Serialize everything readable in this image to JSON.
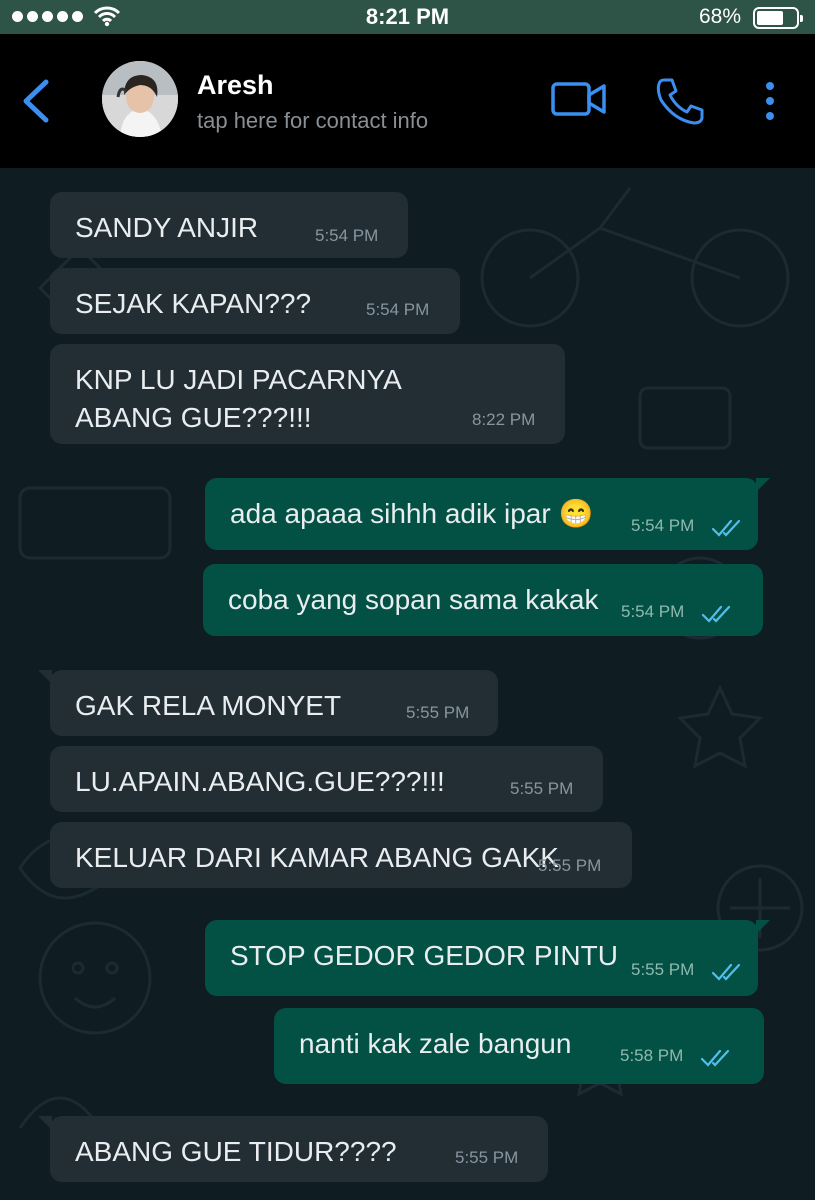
{
  "status_bar": {
    "time": "8:21 PM",
    "battery_percent": "68%",
    "battery_level": 0.68,
    "icons": [
      "signal-dots-icon",
      "wifi-icon",
      "battery-icon"
    ]
  },
  "header": {
    "contact_name": "Aresh",
    "subtitle": "tap here for contact info",
    "icons": [
      "back-chevron-icon",
      "video-call-icon",
      "phone-icon",
      "more-vertical-icon"
    ],
    "accent_color": "#3a8ff0"
  },
  "colors": {
    "incoming_bubble": "#222d34",
    "outgoing_bubble": "#025144",
    "chat_background": "#0f1c22",
    "read_ticks": "#53bdeb"
  },
  "messages": [
    {
      "direction": "in",
      "text": "SANDY ANJIR",
      "time": "5:54 PM"
    },
    {
      "direction": "in",
      "text": "SEJAK KAPAN???",
      "time": "5:54 PM"
    },
    {
      "direction": "in",
      "text": "KNP LU JADI PACARNYA ABANG GUE???!!!",
      "time": "8:22 PM"
    },
    {
      "direction": "out",
      "text": "ada apaaa sihhh adik ipar 😁",
      "time": "5:54 PM",
      "status": "read"
    },
    {
      "direction": "out",
      "text": "coba yang sopan sama kakak",
      "time": "5:54 PM",
      "status": "read"
    },
    {
      "direction": "in",
      "text": "GAK RELA MONYET",
      "time": "5:55 PM"
    },
    {
      "direction": "in",
      "text": "LU.APAIN.ABANG.GUE???!!!",
      "time": "5:55 PM"
    },
    {
      "direction": "in",
      "text": "KELUAR DARI KAMAR ABANG GAKK",
      "time": "5:55 PM"
    },
    {
      "direction": "out",
      "text": "STOP GEDOR GEDOR PINTU",
      "time": "5:55 PM",
      "status": "read"
    },
    {
      "direction": "out",
      "text": "nanti kak zale bangun",
      "time": "5:58 PM",
      "status": "read"
    },
    {
      "direction": "in",
      "text": "ABANG GUE TIDUR????",
      "time": "5:55 PM"
    }
  ]
}
